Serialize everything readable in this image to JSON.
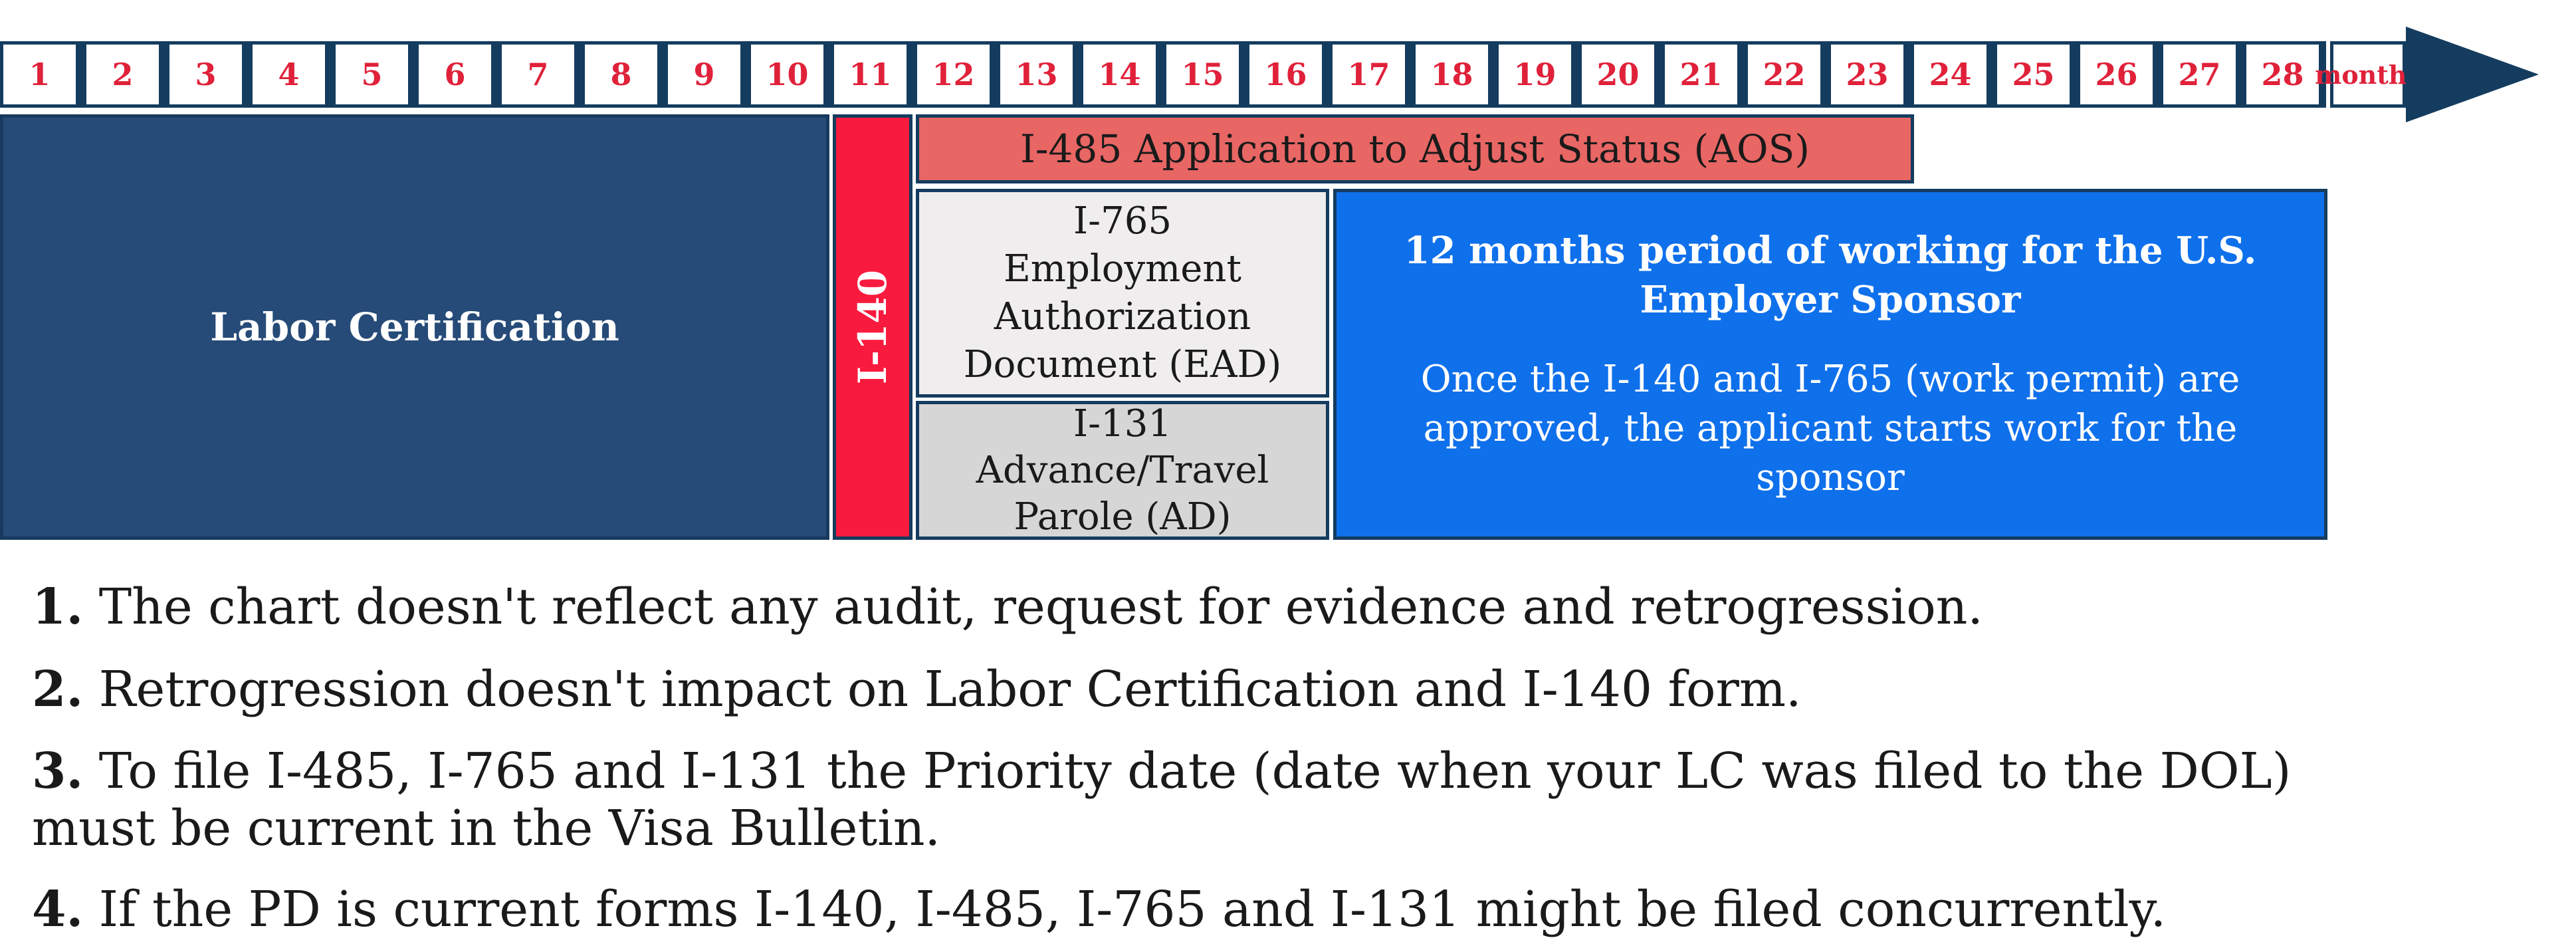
{
  "timeline": {
    "months": [
      "1",
      "2",
      "3",
      "4",
      "5",
      "6",
      "7",
      "8",
      "9",
      "10",
      "11",
      "12",
      "13",
      "14",
      "15",
      "16",
      "17",
      "18",
      "19",
      "20",
      "21",
      "22",
      "23",
      "24",
      "25",
      "26",
      "27",
      "28"
    ],
    "unit_label": "months"
  },
  "phases": {
    "labor_certification": "Labor Certification",
    "i140": "I-140",
    "i485": "I-485 Application to Adjust Status (AOS)",
    "i765": [
      "I-765",
      "Employment",
      "Authorization",
      "Document (EAD)"
    ],
    "i131": [
      "I-131",
      "Advance/Travel",
      "Parole (AD)"
    ],
    "work_period": {
      "title_lines": [
        "12 months period of working for the U.S.",
        "Employer Sponsor"
      ],
      "description_lines": [
        "Once the I-140 and I-765 (work permit) are",
        "approved, the applicant starts work for the sponsor"
      ]
    }
  },
  "notes": [
    {
      "number": "1.",
      "text_lines": [
        "The chart doesn't reflect any audit, request for evidence and retrogression."
      ]
    },
    {
      "number": "2.",
      "text_lines": [
        "Retrogression doesn't impact on Labor Certification and I-140 form."
      ]
    },
    {
      "number": "3.",
      "text_lines": [
        "To file I-485, I-765 and I-131 the Priority date (date when your LC was filed to the DOL)",
        "must be current in the Visa Bulletin."
      ]
    },
    {
      "number": "4.",
      "text_lines": [
        "If the PD is current forms I-140, I-485, I-765 and I-131 might be filed concurrently."
      ]
    }
  ],
  "colors": {
    "timeline_border": "#143c5f",
    "month_text": "#e0213a",
    "labor_certification": "#264b78",
    "i140": "#f81b3e",
    "i485": "#e86664",
    "i765": "#efedee",
    "i131": "#d6d6d6",
    "work_period": "#0f70eb"
  }
}
